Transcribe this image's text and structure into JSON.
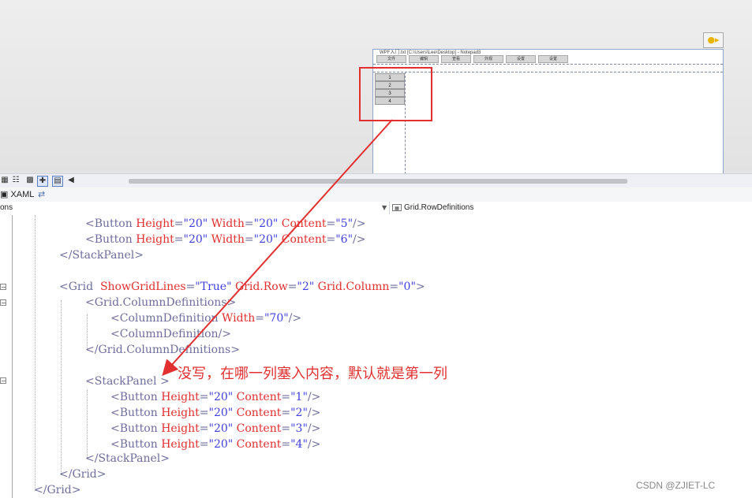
{
  "preview": {
    "title": "WPF入门.txt [C:\\Users\\Lee\\Desktop] - Notepad3",
    "menu": [
      "文件",
      "编辑",
      "查看",
      "外观",
      "设置",
      "设置"
    ],
    "rows": [
      "1",
      "2",
      "3",
      "4"
    ]
  },
  "tabs": {
    "xaml_label": "XAML"
  },
  "navbar": {
    "left": "ons",
    "right": "Grid.RowDefinitions"
  },
  "code": {
    "l1": {
      "tag_open": "<Button ",
      "a1": "Height",
      "eq1": "=",
      "v1": "\"20\"",
      "a2": " Width",
      "eq2": "=",
      "v2": "\"20\"",
      "a3": " Content",
      "eq3": "=",
      "v3": "\"5\"",
      "tag_close": "/>"
    },
    "l2": {
      "tag_open": "<Button ",
      "a1": "Height",
      "eq1": "=",
      "v1": "\"20\"",
      "a2": " Width",
      "eq2": "=",
      "v2": "\"20\"",
      "a3": " Content",
      "eq3": "=",
      "v3": "\"6\"",
      "tag_close": "/>"
    },
    "l3": "</StackPanel>",
    "l4": {
      "tag_open": "<Grid  ",
      "a1": "ShowGridLines",
      "eq1": "=",
      "v1": "\"True\"",
      "a2": " Grid.Row",
      "eq2": "=",
      "v2": "\"2\"",
      "a3": " Grid.Column",
      "eq3": "=",
      "v3": "\"0\"",
      "tag_close": ">"
    },
    "l5": "<Grid.ColumnDefinitions>",
    "l6": {
      "tag_open": "<ColumnDefinition ",
      "a1": "Width",
      "eq1": "=",
      "v1": "\"70\"",
      "tag_close": "/>"
    },
    "l7": "<ColumnDefinition/>",
    "l8": "</Grid.ColumnDefinitions>",
    "l9": "<StackPanel >",
    "l10": {
      "tag_open": "<Button ",
      "a1": "Height",
      "eq1": "=",
      "v1": "\"20\"",
      "a2": " Content",
      "eq2": "=",
      "v2": "\"1\"",
      "tag_close": "/>"
    },
    "l11": {
      "tag_open": "<Button ",
      "a1": "Height",
      "eq1": "=",
      "v1": "\"20\"",
      "a2": " Content",
      "eq2": "=",
      "v2": "\"2\"",
      "tag_close": "/>"
    },
    "l12": {
      "tag_open": "<Button ",
      "a1": "Height",
      "eq1": "=",
      "v1": "\"20\"",
      "a2": " Content",
      "eq2": "=",
      "v2": "\"3\"",
      "tag_close": "/>"
    },
    "l13": {
      "tag_open": "<Button ",
      "a1": "Height",
      "eq1": "=",
      "v1": "\"20\"",
      "a2": " Content",
      "eq2": "=",
      "v2": "\"4\"",
      "tag_close": "/>"
    },
    "l14": "</StackPanel>",
    "l15": "</Grid>",
    "l16": "</Grid>"
  },
  "annotation": {
    "note": "没写，在哪一列塞入内容，默认就是第一列",
    "color": "#e23030"
  },
  "watermark": "CSDN @ZJIET-LC"
}
